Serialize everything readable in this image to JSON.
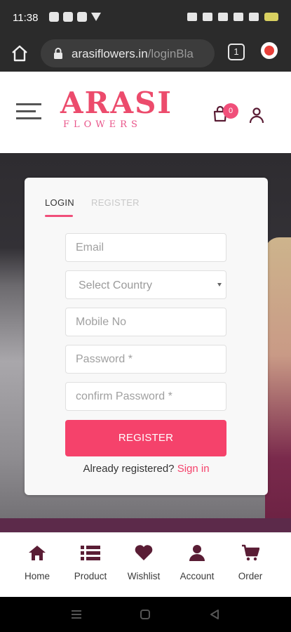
{
  "status_bar": {
    "time": "11:38"
  },
  "browser": {
    "url_main": "arasiflowers.in",
    "url_path": "/loginBla",
    "tab_count": "1"
  },
  "header": {
    "logo_main": "ARASI",
    "logo_sub": "FLOWERS",
    "cart_count": "0"
  },
  "form": {
    "tabs": {
      "login": "LOGIN",
      "register": "REGISTER"
    },
    "email_placeholder": "Email",
    "country_placeholder": "Select Country",
    "mobile_placeholder": "Mobile No",
    "password_placeholder": "Password *",
    "confirm_placeholder": "confirm Password *",
    "register_button": "REGISTER",
    "already_text": "Already registered?",
    "signin_link": "Sign in"
  },
  "bottom_nav": {
    "items": [
      {
        "label": "Home",
        "icon": "home-icon"
      },
      {
        "label": "Product",
        "icon": "list-icon"
      },
      {
        "label": "Wishlist",
        "icon": "heart-icon"
      },
      {
        "label": "Account",
        "icon": "user-icon"
      },
      {
        "label": "Order",
        "icon": "cart-icon"
      }
    ]
  },
  "colors": {
    "accent": "#f5426b",
    "icon_dark": "#5a1d35"
  }
}
